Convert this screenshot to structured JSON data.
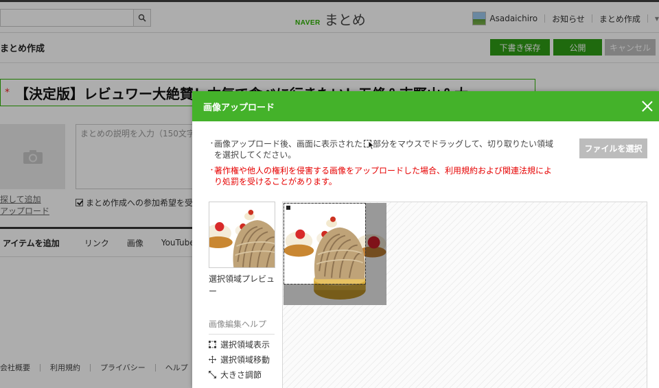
{
  "header": {
    "search_placeholder": "",
    "logo_naver": "NAVER",
    "logo_matome": "まとめ",
    "username": "Asadaichiro",
    "notifications": "お知らせ",
    "create": "まとめ作成"
  },
  "page": {
    "title": "まとめ作成",
    "draft_save": "下書き保存",
    "publish": "公開",
    "cancel": "キャンセル",
    "matome_title": "【決定版】レビュワー大絶賛！本気で食べに行きたい！五條＆吉野山＆大",
    "thumb_link_1": "探して追加",
    "thumb_link_2": "アップロード",
    "desc_placeholder": "まとめの説明を入力（150文字",
    "join_label": "まとめ作成への参加希望を受",
    "item_bar": {
      "lead": "アイテムを追加",
      "tabs": [
        "リンク",
        "画像",
        "YouTube"
      ]
    },
    "footer": [
      "会社概要",
      "利用規約",
      "プライバシー",
      "ヘルプ"
    ]
  },
  "modal": {
    "title": "画像アップロード",
    "note1_a": "画像アップロード後、画面に表示された",
    "note1_b": "部分をマウスでドラッグして、切り取りたい領域",
    "note1_c": "を選択してください。",
    "note2_a": "著作権や他人の権利を侵害する画像をアップロードした場合、利用規約および関連法規によ",
    "note2_b": "り処罰を受けることがあります。",
    "file_button": "ファイルを選択",
    "preview_label": "選択領域プレビュー",
    "help_title": "画像編集ヘルプ",
    "help_items": [
      "選択領域表示",
      "選択領域移動",
      "大きさ調節"
    ]
  },
  "colors": {
    "accent_green": "#44b22a",
    "button_green": "#2e9c15",
    "warning_red": "#e60000"
  }
}
